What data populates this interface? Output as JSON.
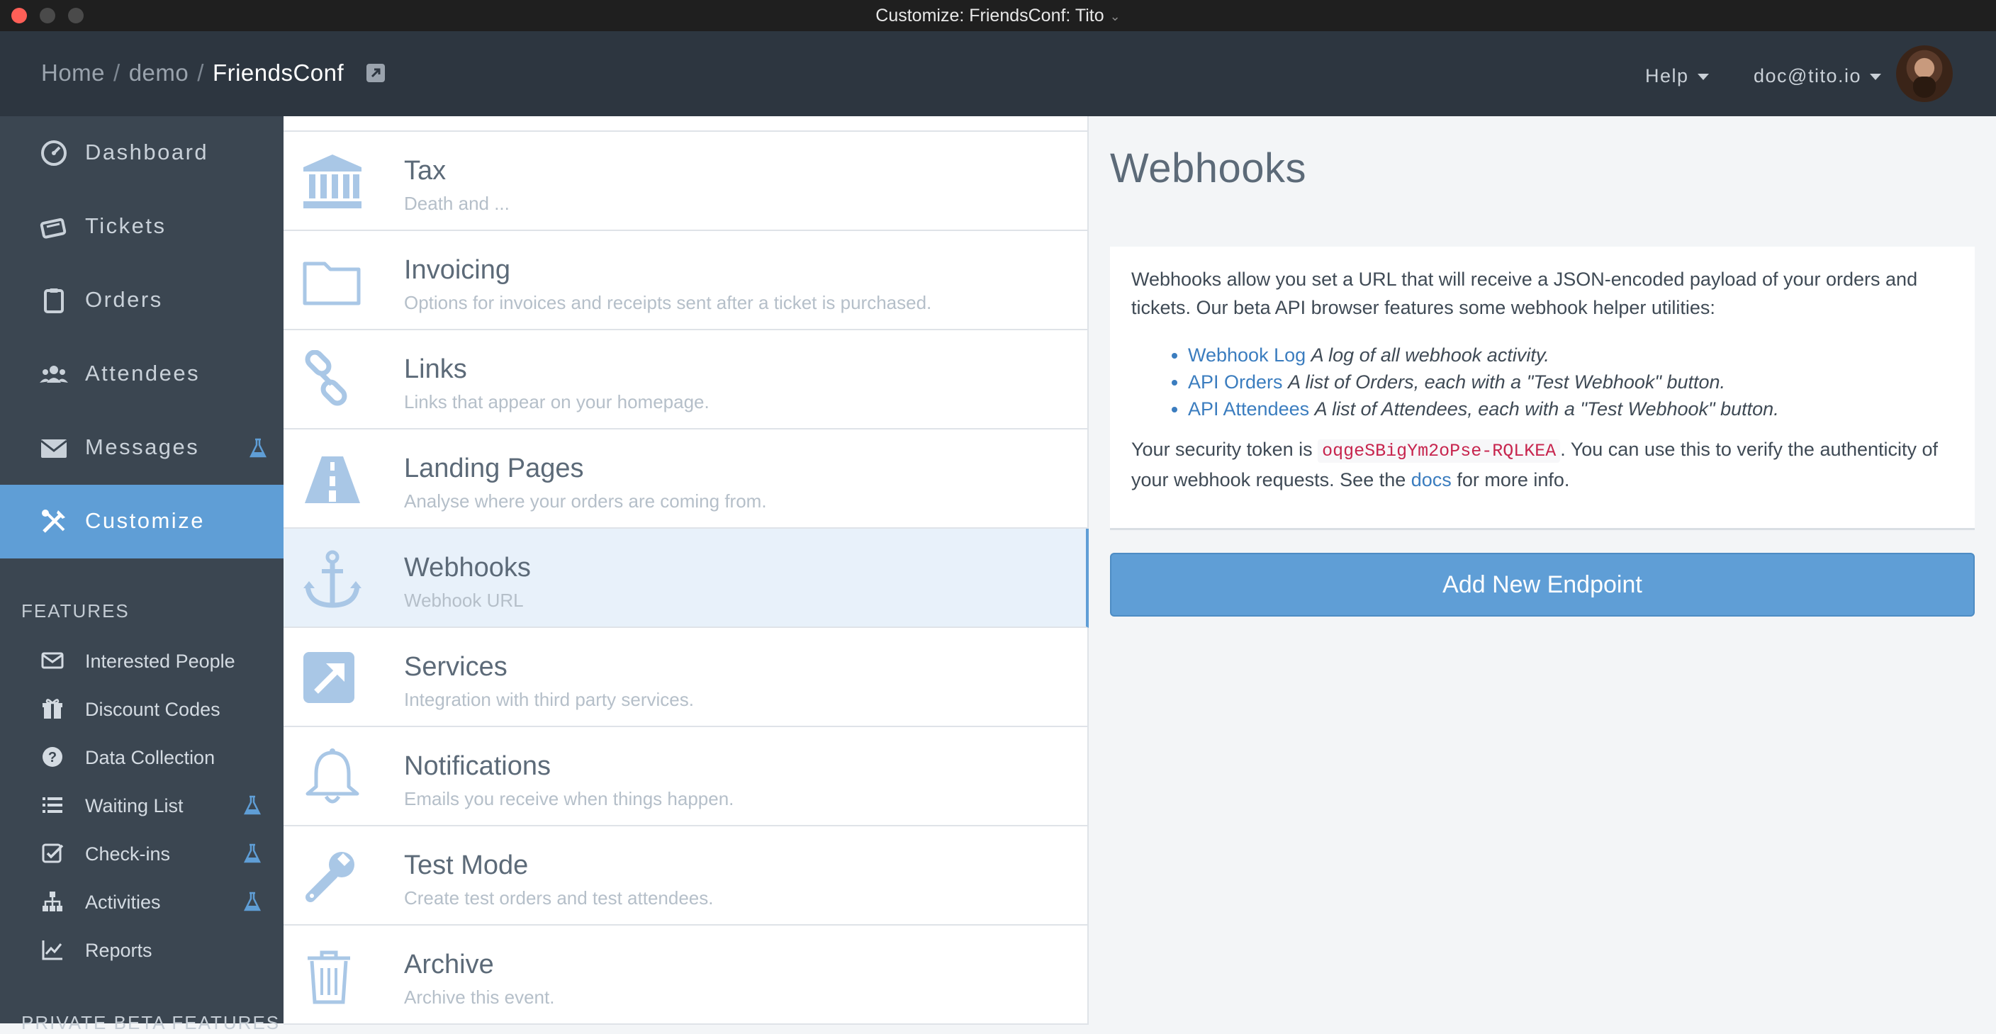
{
  "window": {
    "title": "Customize: FriendsConf: Tito"
  },
  "header": {
    "breadcrumb": [
      "Home",
      "demo",
      "FriendsConf"
    ],
    "help_label": "Help",
    "user_label": "doc@tito.io"
  },
  "sidebar": {
    "items": [
      {
        "label": "Dashboard",
        "icon": "dashboard-icon"
      },
      {
        "label": "Tickets",
        "icon": "tickets-icon"
      },
      {
        "label": "Orders",
        "icon": "clipboard-icon"
      },
      {
        "label": "Attendees",
        "icon": "people-icon"
      },
      {
        "label": "Messages",
        "icon": "envelope-icon",
        "beta": true
      },
      {
        "label": "Customize",
        "icon": "tools-icon",
        "active": true
      }
    ],
    "features_title": "FEATURES",
    "features": [
      {
        "label": "Interested People",
        "icon": "envelope-icon"
      },
      {
        "label": "Discount Codes",
        "icon": "gift-icon"
      },
      {
        "label": "Data Collection",
        "icon": "question-circle-icon"
      },
      {
        "label": "Waiting List",
        "icon": "list-icon",
        "beta": true
      },
      {
        "label": "Check-ins",
        "icon": "check-square-icon",
        "beta": true
      },
      {
        "label": "Activities",
        "icon": "sitemap-icon",
        "beta": true
      },
      {
        "label": "Reports",
        "icon": "line-chart-icon"
      }
    ],
    "private_beta_title": "PRIVATE BETA FEATURES"
  },
  "settings_list": [
    {
      "title": "Tax",
      "subtitle": "Death and ...",
      "icon": "bank-icon"
    },
    {
      "title": "Invoicing",
      "subtitle": "Options for invoices and receipts sent after a ticket is purchased.",
      "icon": "folder-icon"
    },
    {
      "title": "Links",
      "subtitle": "Links that appear on your homepage.",
      "icon": "chain-link-icon"
    },
    {
      "title": "Landing Pages",
      "subtitle": "Analyse where your orders are coming from.",
      "icon": "road-icon"
    },
    {
      "title": "Webhooks",
      "subtitle": "Webhook URL",
      "icon": "anchor-icon",
      "active": true
    },
    {
      "title": "Services",
      "subtitle": "Integration with third party services.",
      "icon": "external-link-square-icon"
    },
    {
      "title": "Notifications",
      "subtitle": "Emails you receive when things happen.",
      "icon": "bell-icon"
    },
    {
      "title": "Test Mode",
      "subtitle": "Create test orders and test attendees.",
      "icon": "wrench-icon"
    },
    {
      "title": "Archive",
      "subtitle": "Archive this event.",
      "icon": "trash-icon"
    }
  ],
  "main": {
    "title": "Webhooks",
    "intro": "Webhooks allow you set a URL that will receive a JSON-encoded payload of your orders and tickets. Our beta API browser features some webhook helper utilities:",
    "links": [
      {
        "link": "Webhook Log",
        "desc": "A log of all webhook activity."
      },
      {
        "link": "API Orders",
        "desc": "A list of Orders, each with a \"Test Webhook\" button."
      },
      {
        "link": "API Attendees",
        "desc": "A list of Attendees, each with a \"Test Webhook\" button."
      }
    ],
    "token_prefix": "Your security token is",
    "token": "oqgeSBigYm2oPse-RQLKEA",
    "token_suffix": ". You can use this to verify the authenticity of your webhook requests. See the",
    "docs_link": "docs",
    "token_end": "for more info.",
    "add_button": "Add New Endpoint"
  },
  "colors": {
    "accent": "#5f9ed6",
    "sidebar": "#3b4651",
    "header": "#2d3640",
    "link": "#3b7dbf",
    "token": "#c7254e"
  }
}
